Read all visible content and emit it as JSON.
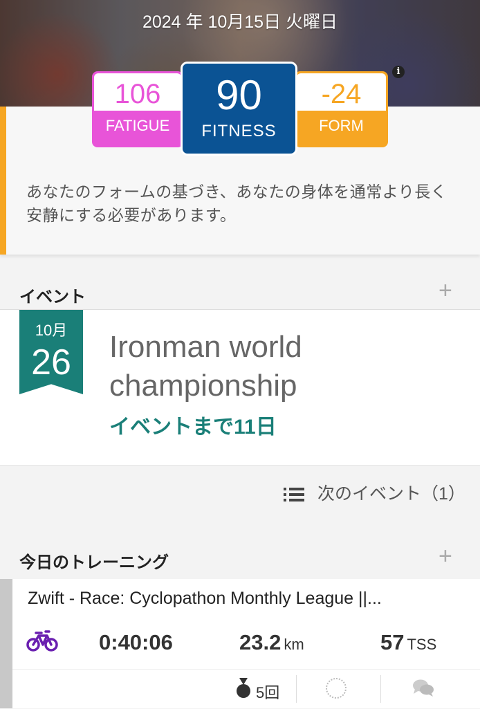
{
  "header": {
    "date": "2024 年 10月15日 火曜日",
    "info_icon": "info-icon"
  },
  "metrics": {
    "fatigue": {
      "value": "106",
      "label": "FATIGUE",
      "color": "#e854d8"
    },
    "fitness": {
      "value": "90",
      "label": "FITNESS",
      "color": "#0b5394"
    },
    "form": {
      "value": "-24",
      "label": "FORM",
      "color": "#f6a623"
    },
    "message": "あなたのフォームの基づき、あなたの身体を通常より長く安静にする必要があります。"
  },
  "events": {
    "heading": "イベント",
    "add_icon": "plus-icon",
    "item": {
      "month": "10月",
      "day": "26",
      "title": "Ironman world championship",
      "countdown": "イベントまで11日",
      "accent": "#1a7f78"
    },
    "next_link": "次のイベント（1）"
  },
  "training": {
    "heading": "今日のトレーニング",
    "add_icon": "plus-icon",
    "workout": {
      "title": "Zwift - Race: Cyclopathon Monthly League ||...",
      "sport_icon": "bike-icon",
      "duration": "0:40:06",
      "distance": "23.2",
      "distance_unit": "km",
      "tss": "57",
      "tss_unit": "TSS",
      "medals": "5回"
    }
  }
}
